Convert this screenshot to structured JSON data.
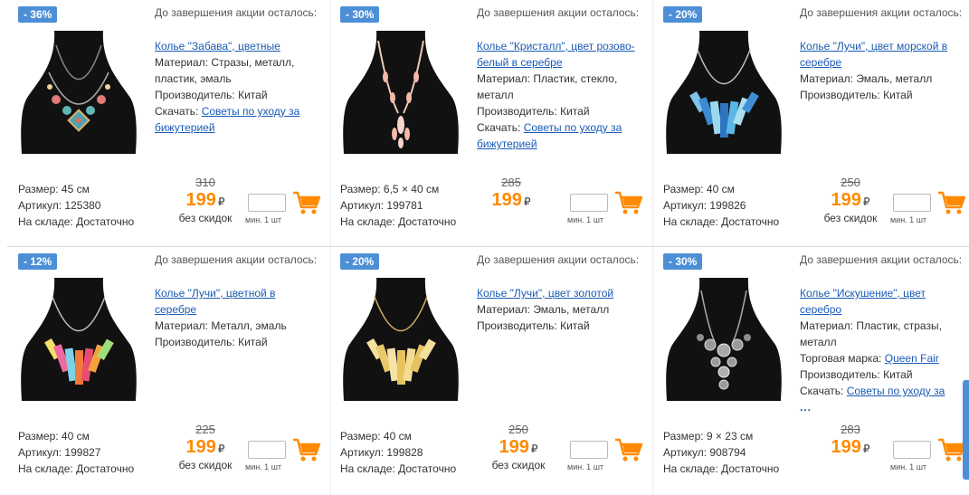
{
  "timer_label": "До завершения акции осталось:",
  "colors": {
    "badge": "#4c8fd6",
    "price": "#ff8a00",
    "link": "#1a5bb5"
  },
  "common": {
    "size_label": "Размер:",
    "article_label": "Артикул:",
    "stock_label": "На складе:",
    "min_qty": "мин. 1 шт",
    "currency": "₽",
    "no_discount": "без скидок"
  },
  "products": [
    {
      "discount": "- 36%",
      "title": "Колье \"Забава\", цветные",
      "material_label": "Материал:",
      "material": "Стразы, металл, пластик, эмаль",
      "maker_label": "Производитель:",
      "maker": "Китай",
      "download_label": "Скачать:",
      "download_link": "Советы по уходу за бижутерией",
      "size": "45 см",
      "article": "125380",
      "stock": "Достаточно",
      "old_price": "310",
      "price": "199",
      "no_discount": "без скидок"
    },
    {
      "discount": "- 30%",
      "title": "Колье \"Кристалл\", цвет розово-белый в серебре",
      "material_label": "Материал:",
      "material": "Пластик, стекло, металл",
      "maker_label": "Производитель:",
      "maker": "Китай",
      "download_label": "Скачать:",
      "download_link": "Советы по уходу за бижутерией",
      "size": "6,5 × 40 см",
      "article": "199781",
      "stock": "Достаточно",
      "old_price": "285",
      "price": "199",
      "no_discount": ""
    },
    {
      "discount": "- 20%",
      "title": "Колье \"Лучи\", цвет морской в серебре",
      "material_label": "Материал:",
      "material": "Эмаль, металл",
      "maker_label": "Производитель:",
      "maker": "Китай",
      "size": "40 см",
      "article": "199826",
      "stock": "Достаточно",
      "old_price": "250",
      "price": "199",
      "no_discount": "без скидок"
    },
    {
      "discount": "- 12%",
      "title": "Колье \"Лучи\", цветной в серебре",
      "material_label": "Материал:",
      "material": "Металл, эмаль",
      "maker_label": "Производитель:",
      "maker": "Китай",
      "size": "40 см",
      "article": "199827",
      "stock": "Достаточно",
      "old_price": "225",
      "price": "199",
      "no_discount": "без скидок"
    },
    {
      "discount": "- 20%",
      "title": "Колье \"Лучи\", цвет золотой",
      "material_label": "Материал:",
      "material": "Эмаль, металл",
      "maker_label": "Производитель:",
      "maker": "Китай",
      "size": "40 см",
      "article": "199828",
      "stock": "Достаточно",
      "old_price": "250",
      "price": "199",
      "no_discount": "без скидок"
    },
    {
      "discount": "- 30%",
      "title": "Колье \"Искушение\", цвет серебро",
      "material_label": "Материал:",
      "material": "Пластик, стразы, металл",
      "brand_label": "Торговая марка:",
      "brand": "Queen Fair",
      "maker_label": "Производитель:",
      "maker": "Китай",
      "download_label": "Скачать:",
      "download_link": "Советы по уходу за",
      "more": "...",
      "size": "9 × 23 см",
      "article": "908794",
      "stock": "Достаточно",
      "old_price": "283",
      "price": "199",
      "no_discount": ""
    }
  ]
}
